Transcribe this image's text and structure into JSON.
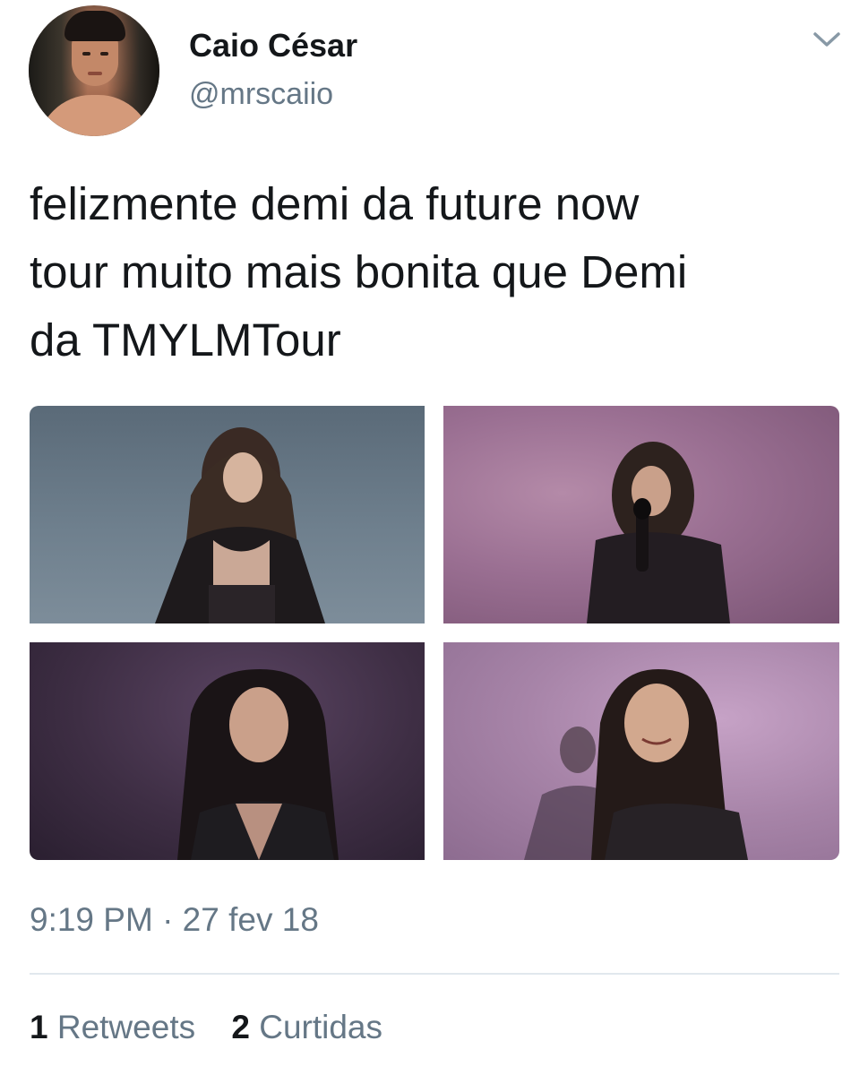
{
  "author": {
    "display_name": "Caio César",
    "handle": "@mrscaiio"
  },
  "tweet": {
    "text": "felizmente demi da future now\ntour muito mais bonita que Demi\nda TMYLMTour",
    "timestamp": "9:19 PM · 27 fev 18"
  },
  "stats": {
    "retweets_count": "1",
    "retweets_label": "Retweets",
    "likes_count": "2",
    "likes_label": "Curtidas"
  },
  "icons": {
    "menu": "chevron-down-icon",
    "avatar": "avatar"
  },
  "colors": {
    "text_primary": "#14171a",
    "text_secondary": "#657786",
    "divider": "#e1e8ed"
  }
}
